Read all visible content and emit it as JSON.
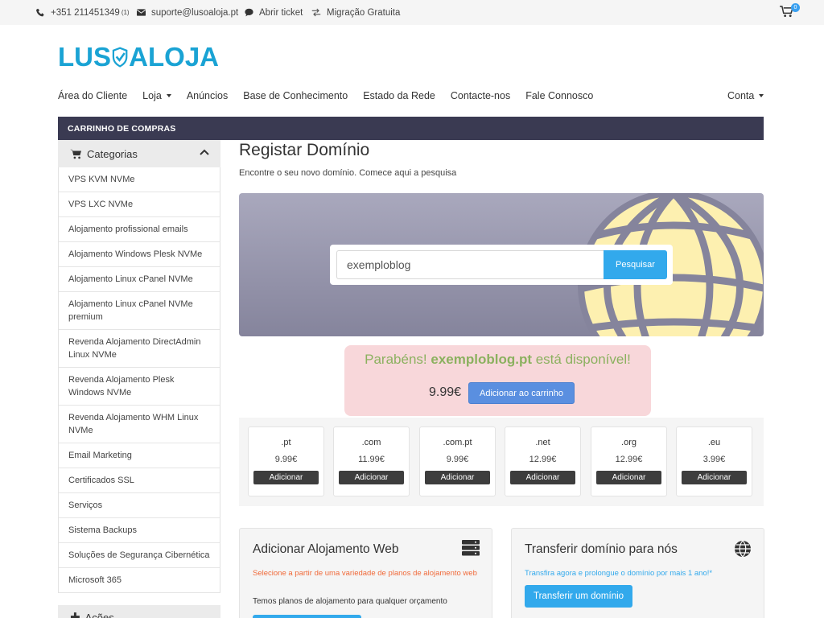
{
  "topbar": {
    "phone": "+351 211451349",
    "phone_sup": "(1)",
    "email": "suporte@lusoaloja.pt",
    "ticket": "Abrir ticket",
    "migration": "Migração Gratuita",
    "cart_count": "0"
  },
  "logo": {
    "part1": "LUS",
    "part2": "ALOJA"
  },
  "nav": {
    "items": [
      "Área do Cliente",
      "Loja",
      "Anúncios",
      "Base de Conhecimento",
      "Estado da Rede",
      "Contacte-nos",
      "Fale Connosco"
    ],
    "account": "Conta"
  },
  "strip": {
    "title": "CARRINHO DE COMPRAS"
  },
  "sidebar": {
    "categories_title": "Categorias",
    "items": [
      "VPS KVM NVMe",
      "VPS LXC NVMe",
      "Alojamento profissional emails",
      "Alojamento Windows Plesk NVMe",
      "Alojamento Linux cPanel NVMe",
      "Alojamento Linux cPanel NVMe premium",
      "Revenda Alojamento DirectAdmin Linux NVMe",
      "Revenda Alojamento Plesk Windows NVMe",
      "Revenda Alojamento WHM Linux NVMe",
      "Email Marketing",
      "Certificados SSL",
      "Serviços",
      "Sistema Backups",
      "Soluções de Segurança Cibernética",
      "Microsoft 365"
    ],
    "actions_title": "Ações"
  },
  "main": {
    "title": "Registar Domínio",
    "subtitle": "Encontre o seu novo domínio. Comece aqui a pesquisa",
    "search_value": "exemploblog",
    "search_button": "Pesquisar",
    "avail_prefix": "Parabéns! ",
    "avail_domain": "exemploblog.pt",
    "avail_suffix": " está disponível!",
    "avail_price": "9.99€",
    "add_to_cart": "Adicionar ao carrinho"
  },
  "tlds": [
    {
      "name": ".pt",
      "price": "9.99€",
      "button": "Adicionar"
    },
    {
      "name": ".com",
      "price": "11.99€",
      "button": "Adicionar"
    },
    {
      "name": ".com.pt",
      "price": "9.99€",
      "button": "Adicionar"
    },
    {
      "name": ".net",
      "price": "12.99€",
      "button": "Adicionar"
    },
    {
      "name": ".org",
      "price": "12.99€",
      "button": "Adicionar"
    },
    {
      "name": ".eu",
      "price": "3.99€",
      "button": "Adicionar"
    }
  ],
  "cards": {
    "hosting": {
      "title": "Adicionar Alojamento Web",
      "desc": "Selecione a partir de uma variedade de planos de alojamento web",
      "sub": "Temos planos de alojamento para qualquer orçamento",
      "desc_color": "#f06a3a"
    },
    "transfer": {
      "title": "Transferir domínio para nós",
      "desc": "Transfira agora e prolongue o domínio por mais 1 ano!*",
      "button": "Transferir um domínio",
      "desc_color": "#32a9ec"
    }
  },
  "colors": {
    "accent": "#32a9ec",
    "strip": "#3a3a52",
    "logo": "#1aa3d4",
    "avail_bg": "#f8d7da",
    "avail_text": "#8bb15f",
    "globe": "#fdf0b0"
  }
}
